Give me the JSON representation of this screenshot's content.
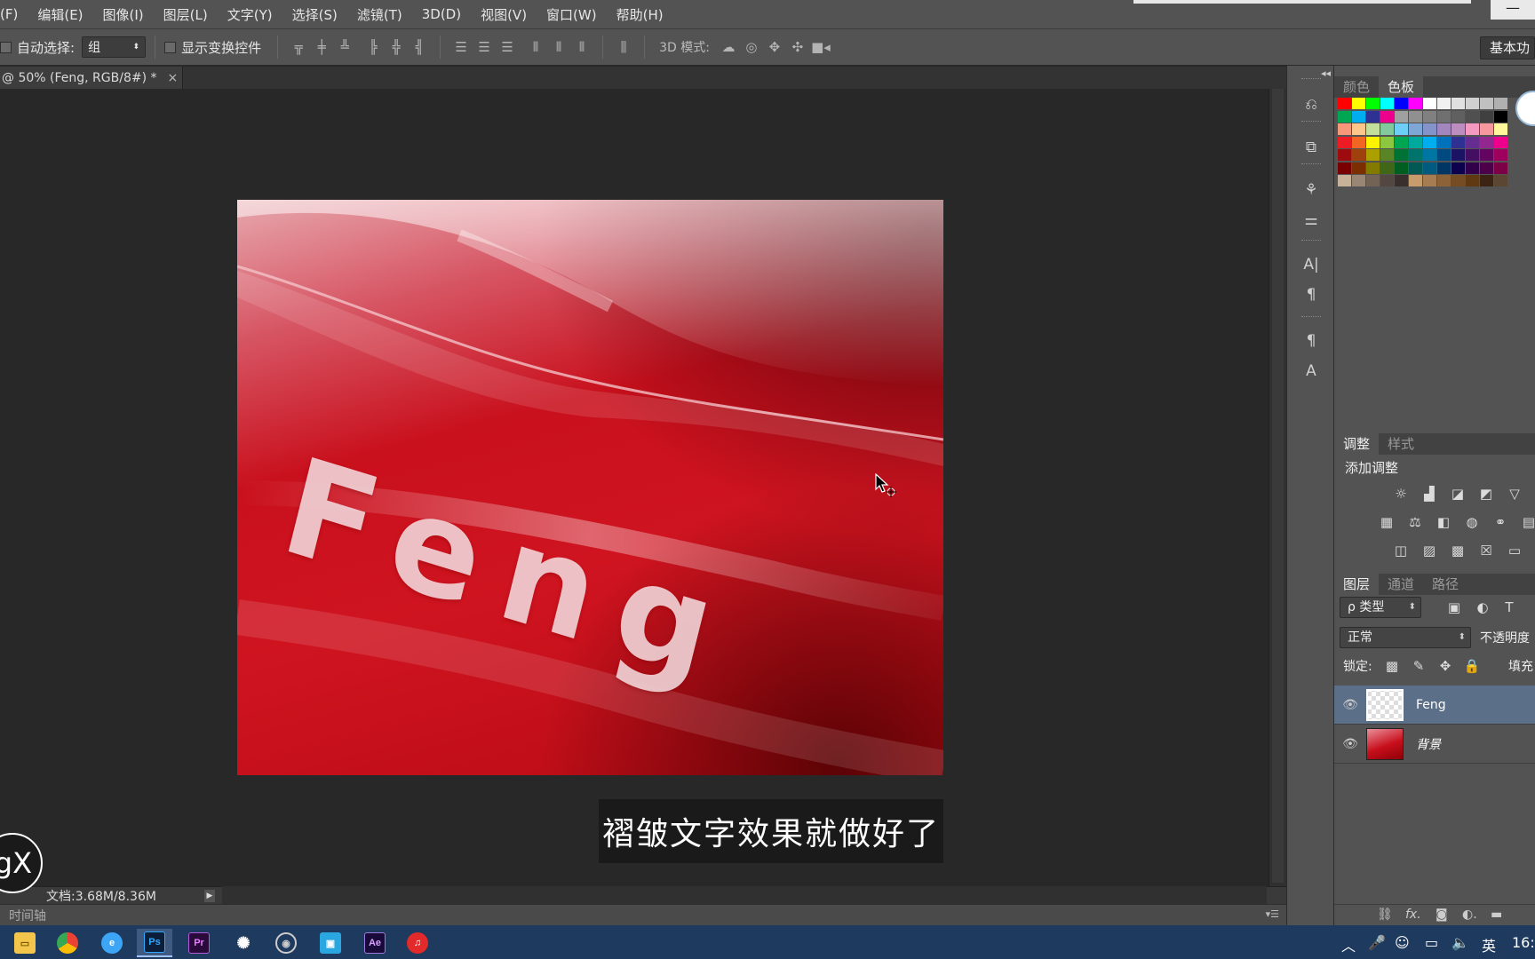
{
  "menu": [
    "(F)",
    "编辑(E)",
    "图像(I)",
    "图层(L)",
    "文字(Y)",
    "选择(S)",
    "滤镜(T)",
    "3D(D)",
    "视图(V)",
    "窗口(W)",
    "帮助(H)"
  ],
  "window_min": "—",
  "options": {
    "auto_select_label": "自动选择:",
    "auto_select_value": "组",
    "show_transform_label": "显示变换控件",
    "mode_3d_label": "3D 模式:",
    "workspace": "基本功"
  },
  "document": {
    "tab_title": "@ 50% (Feng, RGB/8#) *",
    "close": "×"
  },
  "canvas_text": "Feng",
  "subtitle": "褶皱文字效果就做好了",
  "status": {
    "doc_info": "文档:3.68M/8.36M",
    "play": "▶",
    "timeline": "时间轴",
    "timeline_menu": "▾☰"
  },
  "badge_text": "gX",
  "panels": {
    "color_tabs": [
      "颜色",
      "色板"
    ],
    "adjust_tabs": [
      "调整",
      "样式"
    ],
    "add_adjustment": "添加调整",
    "layers_tabs": [
      "图层",
      "通道",
      "路径"
    ],
    "kind_filter": "ρ 类型",
    "blend_mode": "正常",
    "opacity_label": "不透明度",
    "lock_label": "锁定:",
    "fill_label": "填充"
  },
  "layers": [
    {
      "name": "Feng",
      "selected": true
    },
    {
      "name": "背景",
      "selected": false
    }
  ],
  "swatch_rows": [
    [
      "#ff0000",
      "#ffff00",
      "#00ff00",
      "#00ffff",
      "#0000ff",
      "#ff00ff",
      "#ffffff",
      "#f0f0f0",
      "#e0e0e0",
      "#d0d0d0",
      "#c0c0c0",
      "#b0b0b0"
    ],
    [
      "#00a651",
      "#00aeef",
      "#2e3192",
      "#ec008c",
      "#a0a0a0",
      "#909090",
      "#808080",
      "#707070",
      "#606060",
      "#505050",
      "#404040",
      "#000000"
    ],
    [
      "#f7977a",
      "#fdc68a",
      "#c4df9b",
      "#82ca9d",
      "#6ecff6",
      "#7ea7d8",
      "#8493ca",
      "#a187be",
      "#bc8dbf",
      "#f49ac1",
      "#f6989d",
      "#fff79a"
    ],
    [
      "#ed1c24",
      "#f26522",
      "#fff200",
      "#8dc63f",
      "#00a651",
      "#00a99d",
      "#00aeef",
      "#0072bc",
      "#2e3192",
      "#662d91",
      "#92278f",
      "#ec008c"
    ],
    [
      "#9e0b0f",
      "#a0410d",
      "#aba000",
      "#598527",
      "#007236",
      "#00746b",
      "#0076a3",
      "#004a80",
      "#1b1464",
      "#440e62",
      "#630460",
      "#9e005d"
    ],
    [
      "#790000",
      "#7b2e00",
      "#827b00",
      "#406618",
      "#005e20",
      "#005952",
      "#005b7f",
      "#003663",
      "#0d004c",
      "#32004b",
      "#4b0049",
      "#7b0046"
    ],
    [
      "#c7b299",
      "#998675",
      "#736357",
      "#534741",
      "#37302d",
      "#c69c6d",
      "#a67c52",
      "#8c6239",
      "#754c24",
      "#603913",
      "#3c2415",
      "#5b4632"
    ]
  ],
  "taskbar": {
    "apps": [
      "explorer",
      "chrome",
      "browser",
      "Ps",
      "Pr",
      "app5",
      "app6",
      "app7",
      "Ae",
      "netease"
    ],
    "ime": "英",
    "clock": "16:"
  }
}
